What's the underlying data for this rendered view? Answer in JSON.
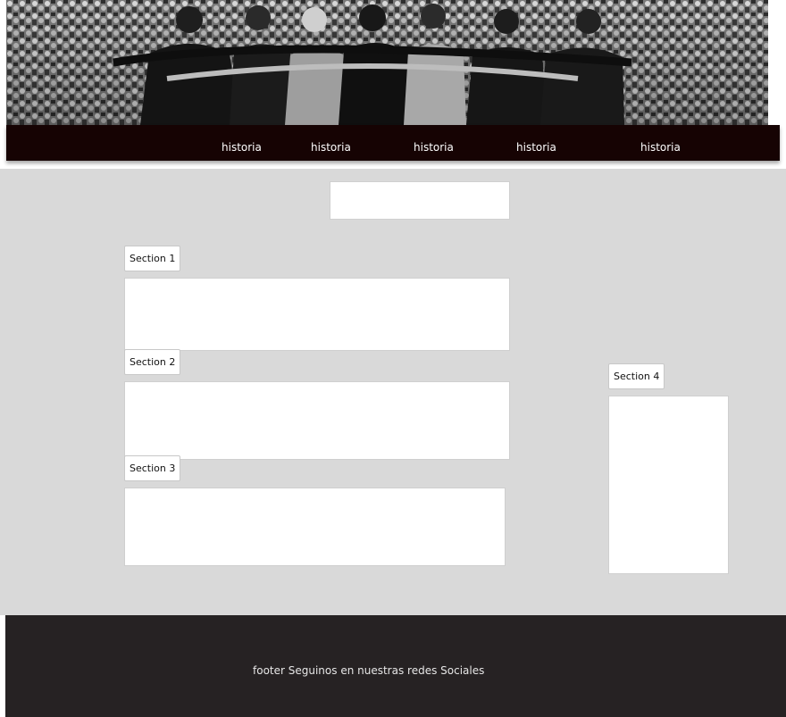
{
  "header": {
    "banner_image": "crowd-photo-banner"
  },
  "nav": {
    "items": [
      {
        "label": "historia"
      },
      {
        "label": "historia"
      },
      {
        "label": "historia"
      },
      {
        "label": "historia"
      },
      {
        "label": "historia"
      }
    ]
  },
  "sections": [
    {
      "label": "Section 1"
    },
    {
      "label": "Section 2"
    },
    {
      "label": "Section 3"
    },
    {
      "label": "Section 4"
    }
  ],
  "footer": {
    "text": "footer Seguinos en nuestras redes Sociales"
  },
  "colors": {
    "nav_bg": "#160303",
    "main_bg": "#d9d9d9",
    "footer_bg": "#262223"
  }
}
